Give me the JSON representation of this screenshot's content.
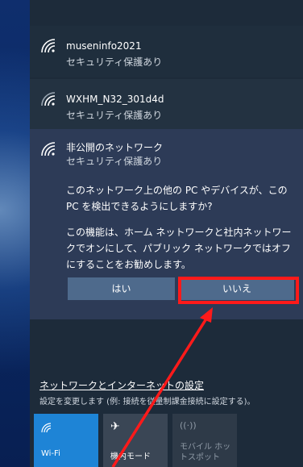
{
  "networks": [
    {
      "name": "museninfo2021",
      "status": "セキュリティ保護あり"
    },
    {
      "name": "WXHM_N32_301d4d",
      "status": "セキュリティ保護あり"
    },
    {
      "name": "非公開のネットワーク",
      "status": "セキュリティ保護あり"
    }
  ],
  "prompt": {
    "question": "このネットワーク上の他の PC やデバイスが、この PC を検出できるようにしますか?",
    "info": "この機能は、ホーム ネットワークと社内ネットワークでオンにして、パブリック ネットワークではオフにすることをお勧めします。",
    "yes_label": "はい",
    "no_label": "いいえ"
  },
  "settings": {
    "link": "ネットワークとインターネットの設定",
    "sub": "設定を変更します (例: 接続を従量制課金接続に設定する)。"
  },
  "tiles": [
    {
      "label": "Wi-Fi",
      "icon": "wifi-icon"
    },
    {
      "label": "機内モード",
      "icon": "airplane-icon"
    },
    {
      "label": "モバイル ホットスポット",
      "icon": "hotspot-icon"
    }
  ],
  "colors": {
    "accent": "#1e84d6",
    "highlight": "#ff1a1a"
  }
}
